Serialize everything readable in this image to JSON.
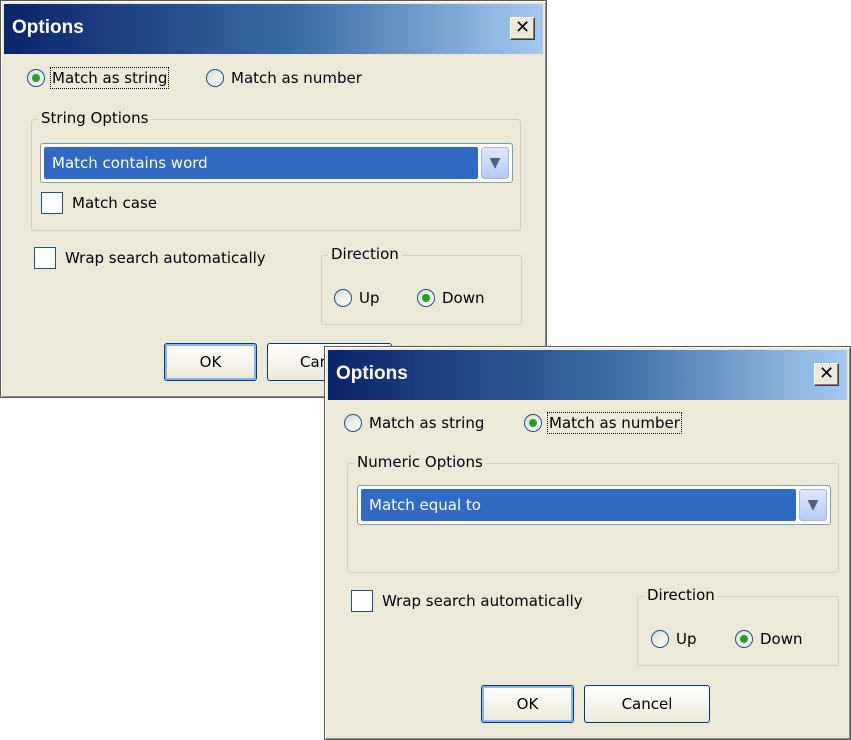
{
  "dialog1": {
    "title": "Options",
    "close_symbol": "✕",
    "match_as_string": "Match as string",
    "match_as_number": "Match as number",
    "selected_mode": "string",
    "group_title": "String Options",
    "combo_value": "Match contains word",
    "match_case_label": "Match case",
    "match_case_checked": false,
    "wrap_label": "Wrap search automatically",
    "wrap_checked": false,
    "direction_title": "Direction",
    "up_label": "Up",
    "down_label": "Down",
    "direction": "down",
    "ok_label": "OK",
    "cancel_label_visible": "Car"
  },
  "dialog2": {
    "title": "Options",
    "close_symbol": "✕",
    "match_as_string": "Match as string",
    "match_as_number": "Match as number",
    "selected_mode": "number",
    "group_title": "Numeric Options",
    "combo_value": "Match equal to",
    "wrap_label": "Wrap search automatically",
    "wrap_checked": false,
    "direction_title": "Direction",
    "up_label": "Up",
    "down_label": "Down",
    "direction": "down",
    "ok_label": "OK",
    "cancel_label": "Cancel"
  },
  "icons": {
    "combo_arrow": "chevron-down-icon",
    "close": "close-icon"
  },
  "colors": {
    "dialog_bg": "#ece9d8",
    "title_gradient_start": "#0a246a",
    "title_gradient_end": "#a6caf0",
    "selection": "#316ac5",
    "radio_dot": "#21a121"
  }
}
